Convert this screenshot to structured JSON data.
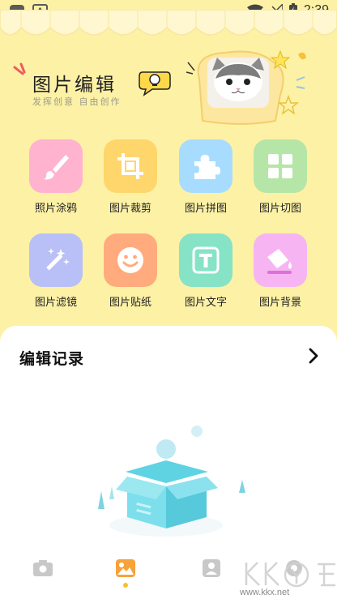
{
  "status_bar": {
    "time": "2:39",
    "left_icons": [
      "app-square-icon",
      "a-notification-icon"
    ],
    "right_icons": [
      "wifi-icon",
      "signal-icon",
      "battery-charging-icon"
    ]
  },
  "header": {
    "title": "图片编辑",
    "subtitle": "发挥创意 自由创作"
  },
  "tools": [
    {
      "label": "照片涂鸦",
      "icon": "brush-icon",
      "color": "#ffb3cf"
    },
    {
      "label": "图片裁剪",
      "icon": "crop-icon",
      "color": "#ffd66b"
    },
    {
      "label": "图片拼图",
      "icon": "puzzle-icon",
      "color": "#a8dcff"
    },
    {
      "label": "图片切图",
      "icon": "grid-icon",
      "color": "#b5e6a8"
    },
    {
      "label": "图片滤镜",
      "icon": "magic-wand-icon",
      "color": "#b9bff7"
    },
    {
      "label": "图片贴纸",
      "icon": "smiley-icon",
      "color": "#ffab7d"
    },
    {
      "label": "图片文字",
      "icon": "text-icon",
      "color": "#86e3c6"
    },
    {
      "label": "图片背景",
      "icon": "paint-bucket-icon",
      "color": "#f7b4f3"
    }
  ],
  "history": {
    "title": "编辑记录"
  },
  "nav": {
    "items": [
      "camera-icon",
      "gallery-icon",
      "profile-icon",
      "settings-icon"
    ],
    "active": 1
  },
  "watermark": {
    "text": "www.kkx.net"
  },
  "colors": {
    "background": "#fdf1a6",
    "accent": "#f6c22a",
    "panel": "#ffffff"
  }
}
